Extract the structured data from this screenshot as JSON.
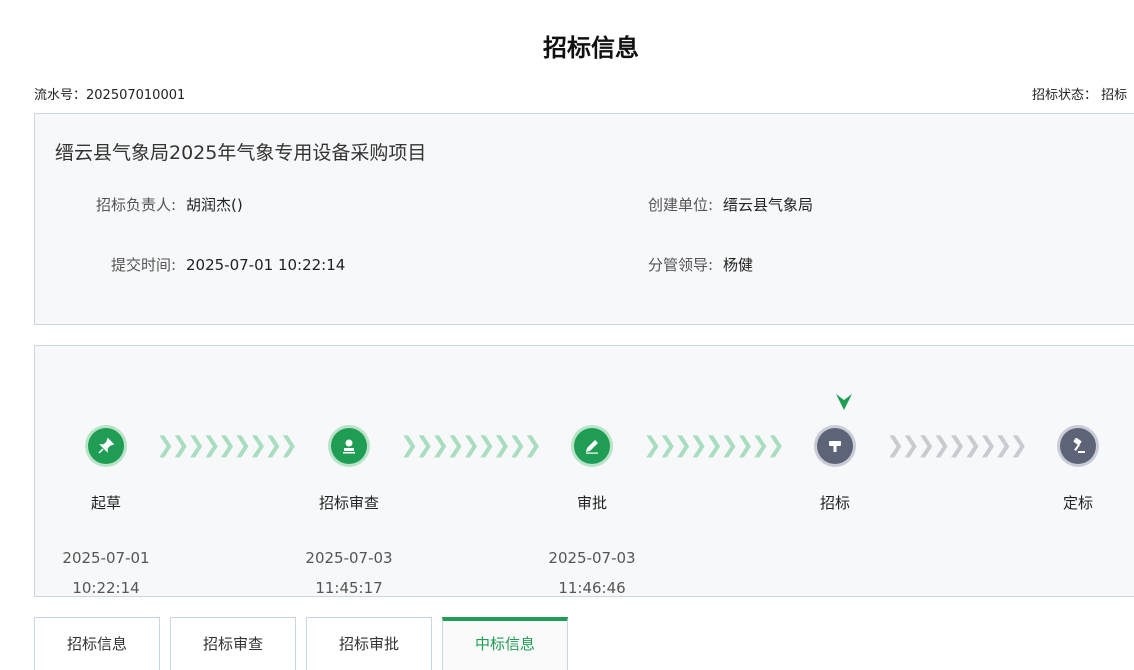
{
  "page": {
    "title": "招标信息"
  },
  "header": {
    "serial_label": "流水号：",
    "serial_value": "202507010001",
    "status_label": "招标状态：",
    "status_value": "招标"
  },
  "project": {
    "title": "缙云县气象局2025年气象专用设备采购项目",
    "fields": [
      {
        "label": "招标负责人:",
        "value": "胡润杰()"
      },
      {
        "label": "提交时间:",
        "value": "2025-07-01 10:22:14"
      },
      {
        "label": "创建单位:",
        "value": "缙云县气象局"
      },
      {
        "label": "分管领导:",
        "value": "杨健"
      }
    ]
  },
  "steps": [
    {
      "name": "起草",
      "date": "2025-07-01",
      "time": "10:22:14",
      "state": "done",
      "icon": "pin-icon"
    },
    {
      "name": "招标审查",
      "date": "2025-07-03",
      "time": "11:45:17",
      "state": "done",
      "icon": "stamp-icon"
    },
    {
      "name": "审批",
      "date": "2025-07-03",
      "time": "11:46:46",
      "state": "done",
      "icon": "edit-icon"
    },
    {
      "name": "招标",
      "date": "",
      "time": "",
      "state": "current",
      "icon": "gavel-head-icon"
    },
    {
      "name": "定标",
      "date": "",
      "time": "",
      "state": "todo",
      "icon": "gavel-icon"
    }
  ],
  "tabs": [
    {
      "label": "招标信息"
    },
    {
      "label": "招标审查"
    },
    {
      "label": "招标审批"
    },
    {
      "label": "中标信息",
      "active": true
    }
  ],
  "colors": {
    "accent": "#1f9d55",
    "inactive_step": "#5d6478",
    "border": "#c9d6e8"
  }
}
